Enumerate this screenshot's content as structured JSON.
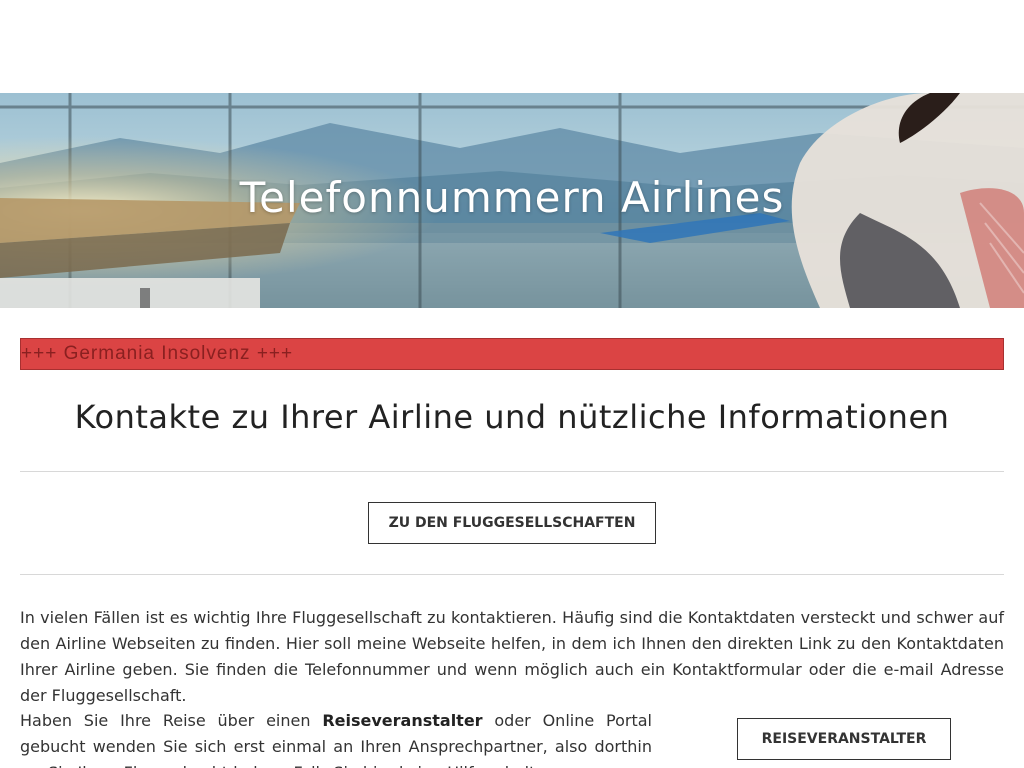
{
  "hero": {
    "title": "Telefonnummern Airlines"
  },
  "ticker": {
    "text": "+++ Germania Insolvenz +++",
    "background": "#db4444"
  },
  "main": {
    "headline": "Kontakte zu Ihrer Airline und nützliche Informationen",
    "airlines_button": "ZU DEN FLUGGESELLSCHAFTEN",
    "intro_paragraph": "In vielen Fällen ist es wichtig Ihre Fluggesellschaft zu kontaktieren. Häufig sind die Kontaktdaten versteckt und schwer auf den Airline Webseiten zu finden. Hier soll meine Webseite helfen, in dem ich Ihnen den direkten Link zu den Kontaktdaten Ihrer Airline geben. Sie finden die Telefonnummer und wenn möglich auch ein Kontaktformular oder die e-mail Adresse der Fluggesellschaft.",
    "tour_paragraph": {
      "before": "Haben Sie Ihre Reise über einen ",
      "bold": "Reiseveranstalter",
      "after": " oder Online Portal gebucht wenden Sie sich erst einmal an Ihren Ansprechpartner, also dorthin wo Sie Ihren Flug gebucht haben. Falls Sie hier keine Hilfe erhalten"
    },
    "tour_button": "REISEVERANSTALTER"
  }
}
